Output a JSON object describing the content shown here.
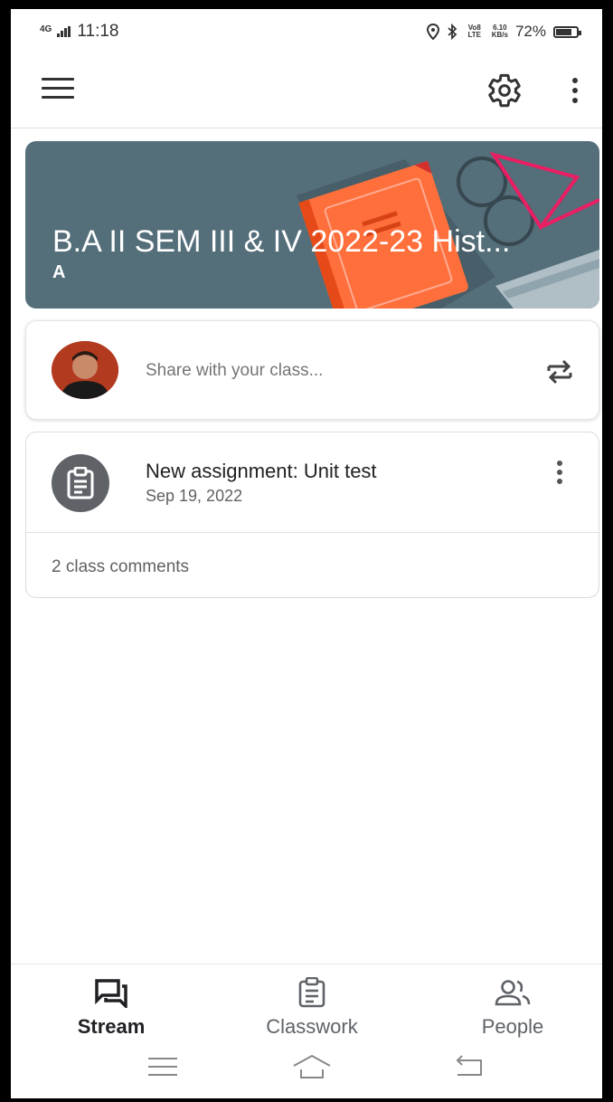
{
  "status_bar": {
    "network": "4G",
    "time": "11:18",
    "volte": "Vo8 LTE",
    "speed_value": "6.10",
    "speed_unit": "KB/s",
    "battery": "72%"
  },
  "icons": {
    "menu": "hamburger-icon",
    "settings": "gear-icon",
    "more": "more-vert-icon",
    "repost": "repost-icon",
    "assignment": "assignment-icon",
    "stream": "stream-icon",
    "classwork": "classwork-icon",
    "people": "people-icon"
  },
  "colors": {
    "banner": "#546e7a",
    "book": "#ff6f3c",
    "glasses": "#e91e63"
  },
  "class_banner": {
    "title": "B.A II SEM III & IV 2022-23 Hist...",
    "section": "A"
  },
  "share": {
    "placeholder": "Share with your class..."
  },
  "stream_items": [
    {
      "title": "New assignment: Unit test",
      "date": "Sep 19, 2022",
      "comments": "2 class comments"
    }
  ],
  "bottom_nav": {
    "tabs": [
      {
        "label": "Stream",
        "active": true
      },
      {
        "label": "Classwork",
        "active": false
      },
      {
        "label": "People",
        "active": false
      }
    ]
  }
}
